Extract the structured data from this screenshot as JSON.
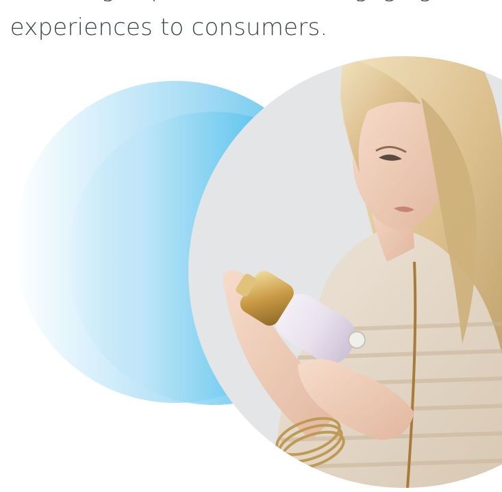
{
  "headline": {
    "line1": "Delivering experiences and engaging",
    "line2": "l experiences to consumers."
  },
  "colors": {
    "text": "#3f4448",
    "blue_light": "#a9ddf5",
    "blue_strong": "#2cb2e8",
    "photo_background": "#e4e5e7"
  },
  "photo": {
    "alt": "Woman examining a cosmetic bottle"
  }
}
